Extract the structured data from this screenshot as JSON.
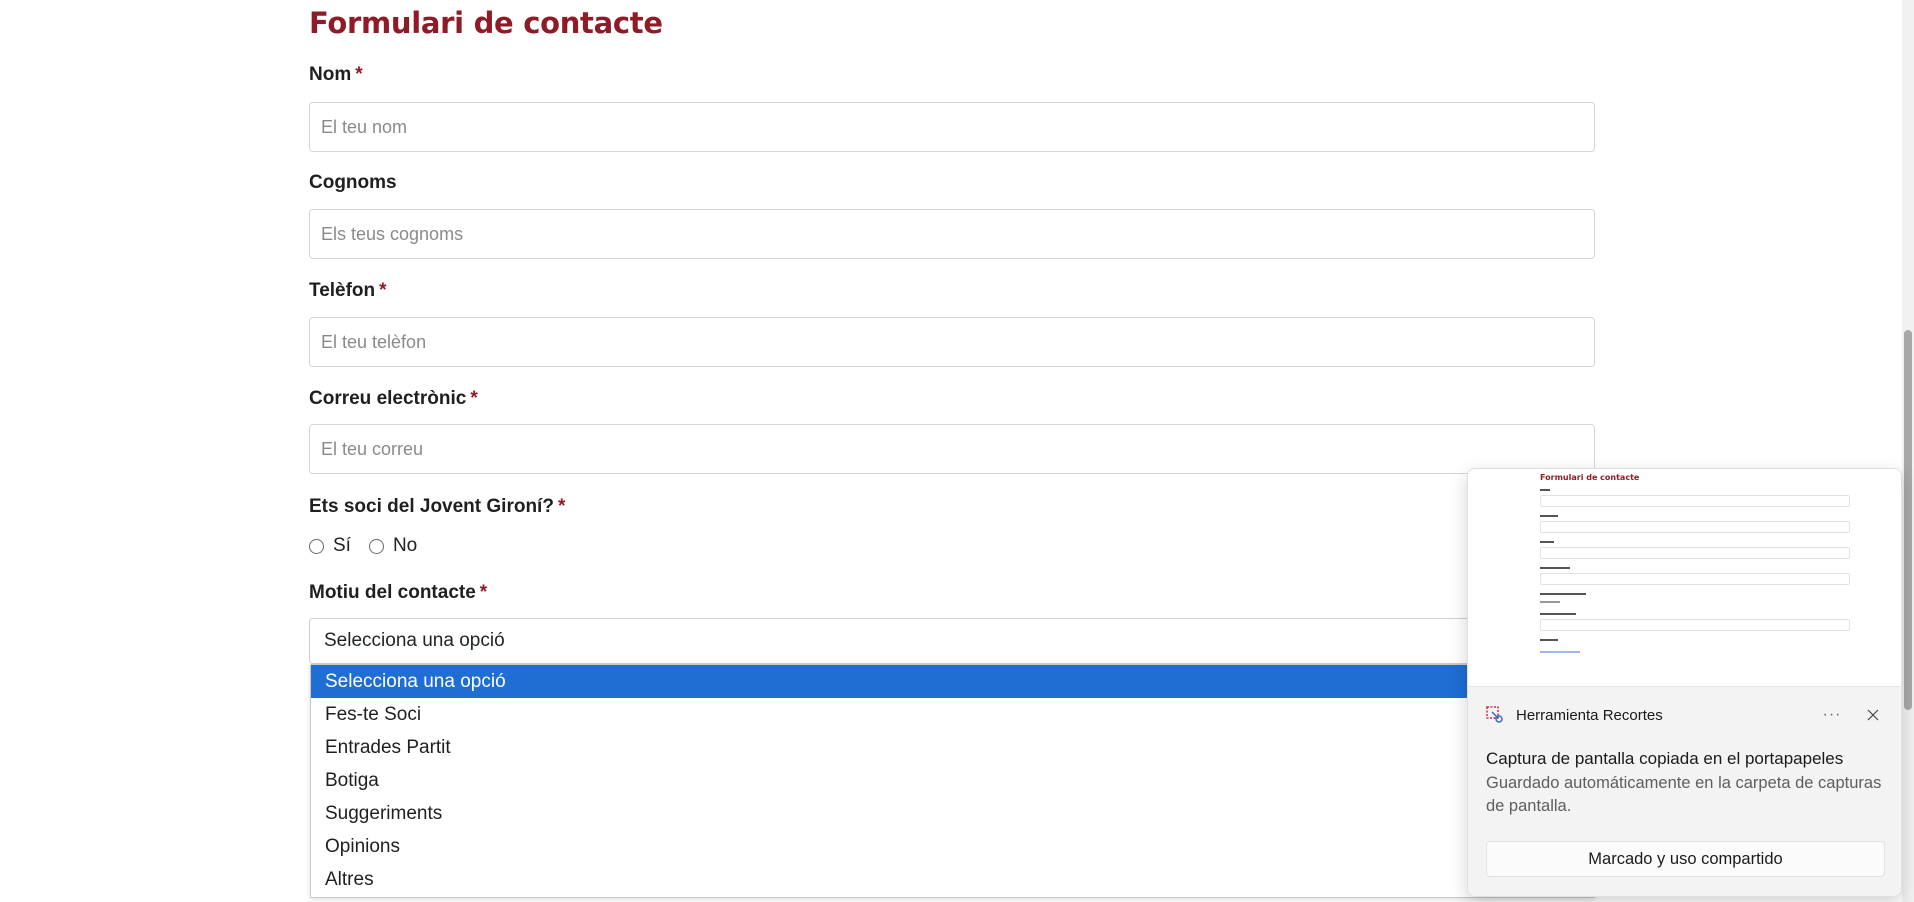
{
  "form": {
    "title": "Formulari de contacte",
    "required_mark": "*",
    "fields": [
      {
        "label": "Nom",
        "placeholder": "El teu nom"
      },
      {
        "label": "Cognoms",
        "placeholder": "Els teus cognoms"
      },
      {
        "label": "Telèfon",
        "placeholder": "El teu telèfon"
      },
      {
        "label": "Correu electrònic",
        "placeholder": "El teu correu"
      }
    ],
    "member_question": "Ets soci del Jovent Gironí?",
    "member_options": [
      "Sí",
      "No"
    ],
    "reason_label": "Motiu del contacte",
    "reason_selected": "Selecciona una opció",
    "reason_options": [
      "Selecciona una opció",
      "Fes-te Soci",
      "Entrades Partit",
      "Botiga",
      "Suggeriments",
      "Opinions",
      "Altres"
    ]
  },
  "notification": {
    "app_name": "Herramienta Recortes",
    "more_label": "···",
    "title": "Captura de pantalla copiada en el portapapeles",
    "body": "Guardado automáticamente en la carpeta de capturas de pantalla.",
    "action_label": "Marcado y uso compartido",
    "preview_title": "Formulari de contacte"
  },
  "colors": {
    "accent": "#8e1b25",
    "selection": "#1f6ed4"
  }
}
